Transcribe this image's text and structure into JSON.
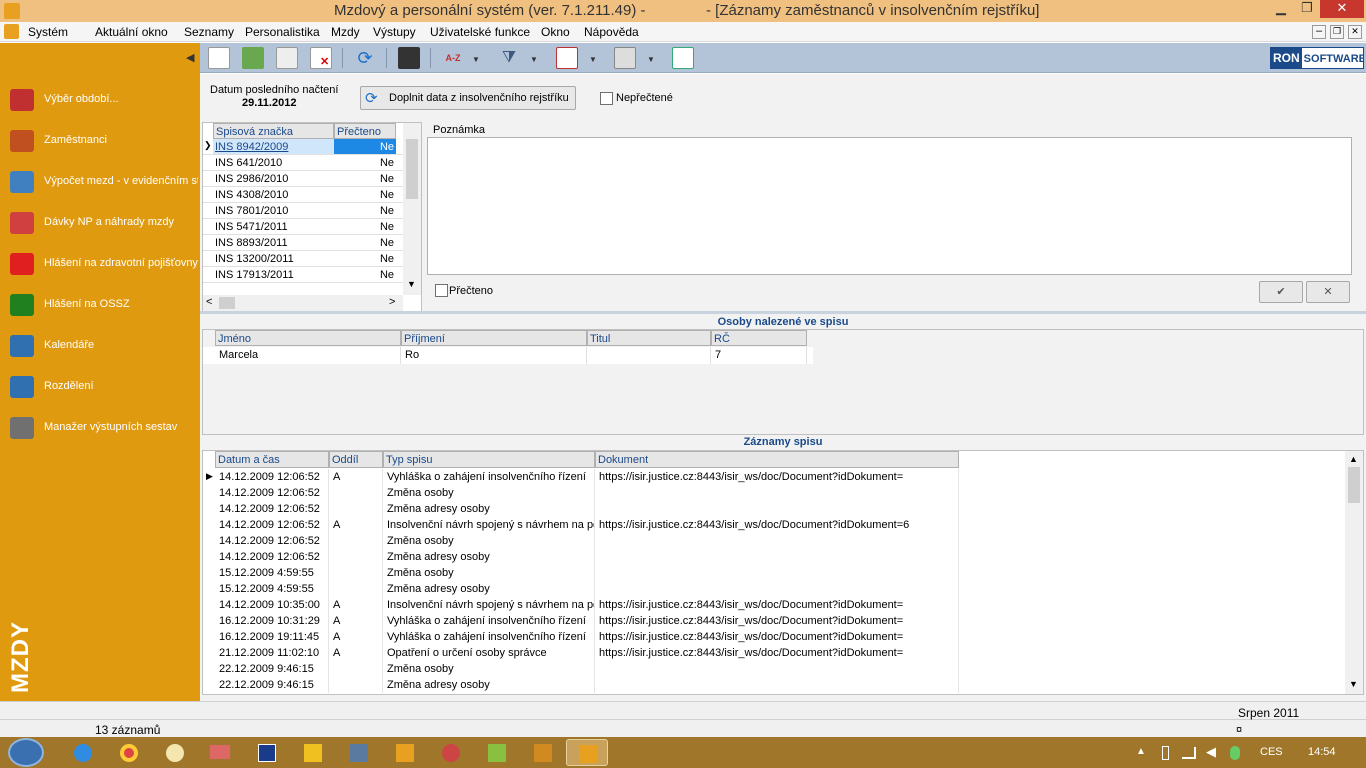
{
  "window": {
    "title_left": "Mzdový a personální systém (ver. 7.1.211.49) -",
    "title_right": "- [Záznamy zaměstnanců v insolvenčním rejstříku]",
    "controls": {
      "minimize": "▁",
      "maximize": "❐",
      "close": "✕"
    },
    "mdi_controls": {
      "minimize": "–",
      "restore": "❐",
      "close": "✕"
    }
  },
  "menu": [
    "Systém",
    "Aktuální okno",
    "Seznamy",
    "Personalistika",
    "Mzdy",
    "Výstupy",
    "Uživatelské funkce",
    "Okno",
    "Nápověda"
  ],
  "sidebar": {
    "collapse_glyph": "◀",
    "items": [
      {
        "label": "Výběr období...",
        "icon": "calendar-select-icon",
        "color": "#c03030"
      },
      {
        "label": "Zaměstnanci",
        "icon": "employee-icon",
        "color": "#c05020"
      },
      {
        "label": "Výpočet mezd - v evidenčním stavu",
        "icon": "payroll-calc-icon",
        "color": "#4080c0"
      },
      {
        "label": "Dávky NP a náhrady mzdy",
        "icon": "sick-benefits-icon",
        "color": "#d04040"
      },
      {
        "label": "Hlášení na zdravotní pojišťovny",
        "icon": "health-insurance-icon",
        "color": "#e02020"
      },
      {
        "label": "Hlášení na OSSZ",
        "icon": "info-icon",
        "color": "#208020"
      },
      {
        "label": "Kalendáře",
        "icon": "calendar-icon",
        "color": "#3070b0"
      },
      {
        "label": "Rozdělení",
        "icon": "distribution-icon",
        "color": "#3070b0"
      },
      {
        "label": "Manažer výstupních sestav",
        "icon": "printer-icon",
        "color": "#707070"
      }
    ],
    "brand": "MZDY"
  },
  "toolbar": {
    "logo_left": "RON",
    "logo_right": "SOFTWARE"
  },
  "header": {
    "last_load_label": "Datum posledního načtení",
    "last_load_date": "29.11.2012",
    "fill_button": "Doplnit data z insolvenčního rejstříku",
    "unread_label": "Nepřečtené"
  },
  "files": {
    "columns": [
      "Spisová značka",
      "Přečteno"
    ],
    "rows": [
      [
        "INS 8942/2009",
        "Ne"
      ],
      [
        "INS 641/2010",
        "Ne"
      ],
      [
        "INS 2986/2010",
        "Ne"
      ],
      [
        "INS 4308/2010",
        "Ne"
      ],
      [
        "INS 7801/2010",
        "Ne"
      ],
      [
        "INS 5471/2011",
        "Ne"
      ],
      [
        "INS 8893/2011",
        "Ne"
      ],
      [
        "INS 13200/2011",
        "Ne"
      ],
      [
        "INS 17913/2011",
        "Ne"
      ]
    ]
  },
  "note": {
    "label": "Poznámka",
    "read_label": "Přečteno",
    "confirm": "✔",
    "cancel": "✕"
  },
  "persons": {
    "title": "Osoby nalezené ve spisu",
    "columns": [
      "Jméno",
      "Příjmení",
      "Titul",
      "RČ"
    ],
    "rows": [
      [
        "Marcela",
        "Ro",
        "",
        "7"
      ]
    ]
  },
  "records": {
    "title": "Záznamy spisu",
    "columns": [
      "Datum a čas",
      "Oddíl",
      "Typ spisu",
      "Dokument"
    ],
    "rows": [
      [
        "14.12.2009 12:06:52",
        "A",
        "Vyhláška o zahájení insolvenčního řízení",
        "https://isir.justice.cz:8443/isir_ws/doc/Document?idDokument="
      ],
      [
        "14.12.2009 12:06:52",
        "",
        "Změna osoby",
        ""
      ],
      [
        "14.12.2009 12:06:52",
        "",
        "Změna adresy osoby",
        ""
      ],
      [
        "14.12.2009 12:06:52",
        "A",
        "Insolvenční návrh spojený s návrhem na povolení oddlužení",
        "https://isir.justice.cz:8443/isir_ws/doc/Document?idDokument=6"
      ],
      [
        "14.12.2009 12:06:52",
        "",
        "Změna osoby",
        ""
      ],
      [
        "14.12.2009 12:06:52",
        "",
        "Změna adresy osoby",
        ""
      ],
      [
        "15.12.2009 4:59:55",
        "",
        "Změna osoby",
        ""
      ],
      [
        "15.12.2009 4:59:55",
        "",
        "Změna adresy osoby",
        ""
      ],
      [
        "14.12.2009 10:35:00",
        "A",
        "Insolvenční návrh spojený s návrhem na povolení oddlužení",
        "https://isir.justice.cz:8443/isir_ws/doc/Document?idDokument="
      ],
      [
        "16.12.2009 10:31:29",
        "A",
        "Vyhláška o zahájení insolvenčního řízení",
        "https://isir.justice.cz:8443/isir_ws/doc/Document?idDokument="
      ],
      [
        "16.12.2009 19:11:45",
        "A",
        "Vyhláška o zahájení insolvenčního řízení",
        "https://isir.justice.cz:8443/isir_ws/doc/Document?idDokument="
      ],
      [
        "21.12.2009 11:02:10",
        "A",
        "Opatření o určení osoby správce",
        "https://isir.justice.cz:8443/isir_ws/doc/Document?idDokument="
      ],
      [
        "22.12.2009 9:46:15",
        "",
        "Změna osoby",
        ""
      ],
      [
        "22.12.2009 9:46:15",
        "",
        "Změna adresy osoby",
        ""
      ]
    ]
  },
  "status": {
    "count": "13 záznamů",
    "period": "Srpen 2011",
    "mark": "¤"
  },
  "taskbar": {
    "lang": "CES",
    "time": "14:54"
  },
  "colors": {
    "sidebar": "#e09a10",
    "toolbar": "#b3c4d8",
    "selection": "#1e88e5",
    "accent_text": "#1a4a8a"
  }
}
